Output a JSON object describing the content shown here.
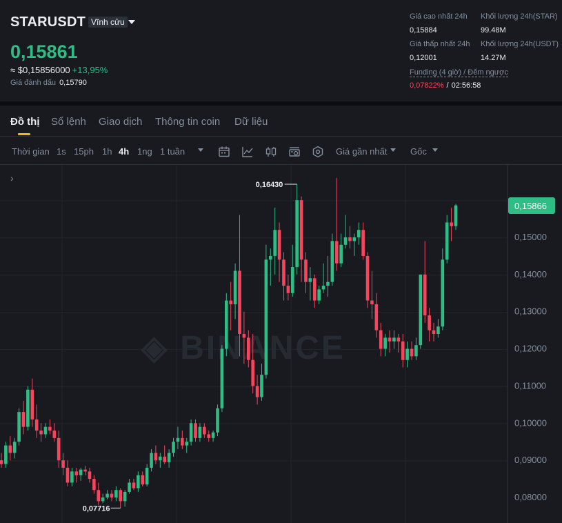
{
  "header": {
    "symbol": "STARUSDT",
    "contract_type": "Vĩnh cửu",
    "last_price": "0,15861",
    "usd_price": "≈ $0,15856000",
    "change_pct": "+13,95%",
    "mark_price_label": "Giá đánh dấu",
    "mark_price": "0,15790",
    "stats": {
      "high_label": "Giá cao nhất 24h",
      "high_value": "0,15884",
      "low_label": "Giá thấp nhất 24h",
      "low_value": "0,12001",
      "vol_star_label": "Khối lượng 24h(STAR)",
      "vol_star_value": "99.48M",
      "vol_usdt_label": "Khối lượng 24h(USDT)",
      "vol_usdt_value": "14.27M"
    },
    "funding_label": "Funding (4 giờ) / Đếm ngược",
    "funding_rate": "0,07822%",
    "funding_sep": "/",
    "countdown": "02:56:58"
  },
  "tabs": [
    "Đồ thị",
    "Sổ lệnh",
    "Giao dịch",
    "Thông tin coin",
    "Dữ liệu"
  ],
  "toolbar": {
    "time_label": "Thời gian",
    "intervals": [
      "1s",
      "15ph",
      "1h",
      "4h",
      "1ng",
      "1 tuần"
    ],
    "active_interval": "4h",
    "price_type": "Giá gần nhất",
    "view": "Gốc",
    "icons": [
      "calendar-icon",
      "indicator-icon",
      "candle-type-icon",
      "layout-icon",
      "settings-icon"
    ]
  },
  "watermark": "BINANCE",
  "colors": {
    "up": "#2ebd85",
    "down": "#f6465d",
    "accent": "#f0b90b",
    "bg": "#181a20",
    "grid": "#22262d",
    "text_muted": "#848e9c"
  },
  "chart_data": {
    "type": "candlestick",
    "interval": "4h",
    "y_ticks": [
      "0,15000",
      "0,14000",
      "0,13000",
      "0,12000",
      "0,11000",
      "0,10000",
      "0,09000",
      "0,08000"
    ],
    "y_tick_values": [
      0.15,
      0.14,
      0.13,
      0.12,
      0.11,
      0.1,
      0.09,
      0.08
    ],
    "last_price_label": "0,15866",
    "last_price_value": 0.15866,
    "high_marker_label": "0,16430",
    "high_marker_value": 0.1643,
    "low_marker_label": "0,07716",
    "low_marker_value": 0.07716,
    "candles": [
      [
        0.09,
        0.092,
        0.088,
        0.089
      ],
      [
        0.089,
        0.095,
        0.088,
        0.094
      ],
      [
        0.094,
        0.0965,
        0.09,
        0.092
      ],
      [
        0.092,
        0.096,
        0.0905,
        0.095
      ],
      [
        0.095,
        0.104,
        0.094,
        0.103
      ],
      [
        0.103,
        0.106,
        0.097,
        0.099
      ],
      [
        0.099,
        0.11,
        0.098,
        0.109
      ],
      [
        0.109,
        0.112,
        0.099,
        0.101
      ],
      [
        0.101,
        0.105,
        0.096,
        0.098
      ],
      [
        0.098,
        0.1,
        0.095,
        0.097
      ],
      [
        0.097,
        0.1,
        0.096,
        0.099
      ],
      [
        0.099,
        0.101,
        0.097,
        0.098
      ],
      [
        0.098,
        0.1,
        0.095,
        0.096
      ],
      [
        0.096,
        0.098,
        0.088,
        0.09
      ],
      [
        0.09,
        0.092,
        0.086,
        0.088
      ],
      [
        0.088,
        0.09,
        0.083,
        0.084
      ],
      [
        0.084,
        0.088,
        0.083,
        0.087
      ],
      [
        0.087,
        0.088,
        0.084,
        0.086
      ],
      [
        0.086,
        0.088,
        0.0845,
        0.0875
      ],
      [
        0.0875,
        0.0885,
        0.086,
        0.087
      ],
      [
        0.087,
        0.088,
        0.084,
        0.085
      ],
      [
        0.085,
        0.086,
        0.081,
        0.082
      ],
      [
        0.082,
        0.084,
        0.078,
        0.079
      ],
      [
        0.079,
        0.081,
        0.0785,
        0.08
      ],
      [
        0.08,
        0.082,
        0.0795,
        0.081
      ],
      [
        0.081,
        0.082,
        0.079,
        0.08
      ],
      [
        0.08,
        0.083,
        0.079,
        0.082
      ],
      [
        0.082,
        0.0825,
        0.0772,
        0.079
      ],
      [
        0.079,
        0.082,
        0.0775,
        0.0815
      ],
      [
        0.0815,
        0.085,
        0.081,
        0.084
      ],
      [
        0.084,
        0.085,
        0.082,
        0.0825
      ],
      [
        0.0825,
        0.087,
        0.0815,
        0.086
      ],
      [
        0.086,
        0.087,
        0.083,
        0.0835
      ],
      [
        0.0835,
        0.089,
        0.083,
        0.088
      ],
      [
        0.088,
        0.093,
        0.087,
        0.092
      ],
      [
        0.092,
        0.094,
        0.089,
        0.09
      ],
      [
        0.09,
        0.092,
        0.088,
        0.091
      ],
      [
        0.091,
        0.094,
        0.089,
        0.0895
      ],
      [
        0.0895,
        0.093,
        0.088,
        0.092
      ],
      [
        0.092,
        0.096,
        0.091,
        0.095
      ],
      [
        0.095,
        0.099,
        0.093,
        0.096
      ],
      [
        0.096,
        0.098,
        0.093,
        0.094
      ],
      [
        0.094,
        0.096,
        0.092,
        0.095
      ],
      [
        0.095,
        0.101,
        0.094,
        0.1
      ],
      [
        0.1,
        0.101,
        0.095,
        0.096
      ],
      [
        0.096,
        0.1,
        0.095,
        0.099
      ],
      [
        0.099,
        0.1,
        0.096,
        0.097
      ],
      [
        0.097,
        0.098,
        0.095,
        0.096
      ],
      [
        0.096,
        0.098,
        0.095,
        0.0975
      ],
      [
        0.0975,
        0.105,
        0.0965,
        0.104
      ],
      [
        0.104,
        0.121,
        0.103,
        0.12
      ],
      [
        0.12,
        0.135,
        0.118,
        0.133
      ],
      [
        0.133,
        0.138,
        0.125,
        0.132
      ],
      [
        0.132,
        0.143,
        0.128,
        0.141
      ],
      [
        0.141,
        0.156,
        0.118,
        0.124
      ],
      [
        0.124,
        0.13,
        0.116,
        0.123
      ],
      [
        0.123,
        0.125,
        0.115,
        0.117
      ],
      [
        0.117,
        0.124,
        0.108,
        0.11
      ],
      [
        0.11,
        0.113,
        0.105,
        0.107
      ],
      [
        0.107,
        0.116,
        0.106,
        0.113
      ],
      [
        0.113,
        0.148,
        0.112,
        0.144
      ],
      [
        0.144,
        0.147,
        0.137,
        0.145
      ],
      [
        0.145,
        0.158,
        0.14,
        0.152
      ],
      [
        0.152,
        0.154,
        0.138,
        0.144
      ],
      [
        0.144,
        0.146,
        0.133,
        0.137
      ],
      [
        0.137,
        0.14,
        0.133,
        0.135
      ],
      [
        0.135,
        0.148,
        0.134,
        0.142
      ],
      [
        0.142,
        0.1643,
        0.14,
        0.16
      ],
      [
        0.16,
        0.161,
        0.138,
        0.144
      ],
      [
        0.144,
        0.146,
        0.135,
        0.138
      ],
      [
        0.138,
        0.142,
        0.133,
        0.139
      ],
      [
        0.139,
        0.14,
        0.131,
        0.133
      ],
      [
        0.133,
        0.137,
        0.132,
        0.136
      ],
      [
        0.136,
        0.143,
        0.135,
        0.137
      ],
      [
        0.137,
        0.145,
        0.134,
        0.138
      ],
      [
        0.138,
        0.151,
        0.137,
        0.149
      ],
      [
        0.149,
        0.166,
        0.141,
        0.143
      ],
      [
        0.143,
        0.151,
        0.142,
        0.148
      ],
      [
        0.148,
        0.156,
        0.147,
        0.15
      ],
      [
        0.15,
        0.153,
        0.147,
        0.149
      ],
      [
        0.149,
        0.151,
        0.145,
        0.15
      ],
      [
        0.15,
        0.154,
        0.148,
        0.152
      ],
      [
        0.152,
        0.154,
        0.144,
        0.145
      ],
      [
        0.145,
        0.146,
        0.131,
        0.133
      ],
      [
        0.133,
        0.141,
        0.128,
        0.132
      ],
      [
        0.132,
        0.135,
        0.123,
        0.125
      ],
      [
        0.125,
        0.127,
        0.118,
        0.12
      ],
      [
        0.12,
        0.124,
        0.118,
        0.123
      ],
      [
        0.123,
        0.125,
        0.119,
        0.122
      ],
      [
        0.122,
        0.125,
        0.12,
        0.123
      ],
      [
        0.123,
        0.124,
        0.119,
        0.122
      ],
      [
        0.122,
        0.124,
        0.115,
        0.117
      ],
      [
        0.117,
        0.122,
        0.115,
        0.12
      ],
      [
        0.12,
        0.122,
        0.117,
        0.118
      ],
      [
        0.118,
        0.123,
        0.117,
        0.121
      ],
      [
        0.121,
        0.127,
        0.12,
        0.14
      ],
      [
        0.14,
        0.149,
        0.127,
        0.129
      ],
      [
        0.129,
        0.131,
        0.122,
        0.125
      ],
      [
        0.125,
        0.127,
        0.122,
        0.124
      ],
      [
        0.124,
        0.128,
        0.123,
        0.126
      ],
      [
        0.126,
        0.147,
        0.125,
        0.144
      ],
      [
        0.144,
        0.156,
        0.143,
        0.154
      ],
      [
        0.154,
        0.158,
        0.149,
        0.153
      ],
      [
        0.153,
        0.159,
        0.152,
        0.1586
      ]
    ]
  }
}
